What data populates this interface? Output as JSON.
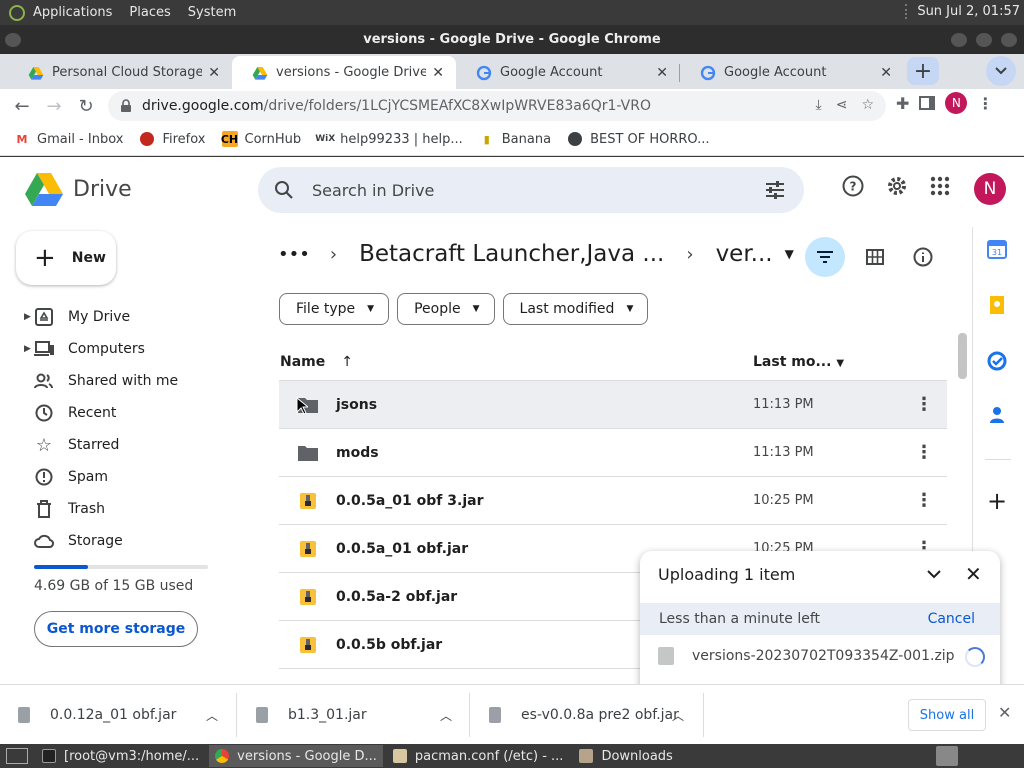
{
  "system_panel": {
    "menus": [
      "Applications",
      "Places",
      "System"
    ],
    "clock": "Sun Jul  2, 01:57"
  },
  "window": {
    "title": "versions - Google Drive - Google Chrome"
  },
  "tabs": [
    {
      "label": "Personal Cloud Storage & F",
      "icon": "google-drive-icon"
    },
    {
      "label": "versions - Google Drive",
      "icon": "google-drive-icon"
    },
    {
      "label": "Google Account",
      "icon": "google-icon"
    },
    {
      "label": "Google Account",
      "icon": "google-icon"
    }
  ],
  "address": {
    "host": "drive.google.com",
    "path": "/drive/folders/1LCjYCSMEAfXC8XwIpWRVE83a6Qr1-VRO"
  },
  "profile_initial": "N",
  "bookmarks": [
    {
      "label": "Gmail - Inbox",
      "icon": "gmail-icon"
    },
    {
      "label": "Firefox",
      "icon": "firefox-icon"
    },
    {
      "label": "CornHub",
      "icon": "ch-icon"
    },
    {
      "label": "help99233 | help...",
      "icon": "wix-icon"
    },
    {
      "label": "Banana",
      "icon": "banana-icon"
    },
    {
      "label": "BEST OF HORRO...",
      "icon": "globe-icon"
    }
  ],
  "drive": {
    "app_name": "Drive",
    "search_placeholder": "Search in Drive",
    "new_label": "New",
    "nav": [
      {
        "label": "My Drive",
        "icon": "my-drive-icon",
        "expandable": true
      },
      {
        "label": "Computers",
        "icon": "computers-icon",
        "expandable": true
      },
      {
        "label": "Shared with me",
        "icon": "shared-icon",
        "expandable": false
      },
      {
        "label": "Recent",
        "icon": "clock-icon",
        "expandable": false
      },
      {
        "label": "Starred",
        "icon": "star-icon",
        "expandable": false
      },
      {
        "label": "Spam",
        "icon": "spam-icon",
        "expandable": false
      },
      {
        "label": "Trash",
        "icon": "trash-icon",
        "expandable": false
      },
      {
        "label": "Storage",
        "icon": "cloud-icon",
        "expandable": false
      }
    ],
    "storage": {
      "used_text": "4.69 GB of 15 GB used",
      "fraction": 0.31
    },
    "get_storage_label": "Get more storage",
    "breadcrumb": {
      "parent": "Betacraft Launcher,Java ...",
      "current": "ver..."
    },
    "filters": [
      "File type",
      "People",
      "Last modified"
    ],
    "columns": {
      "name": "Name",
      "last_modified": "Last mo..."
    },
    "files": [
      {
        "name": "jsons",
        "modified": "11:13 PM",
        "kind": "folder",
        "selected": true
      },
      {
        "name": "mods",
        "modified": "11:13 PM",
        "kind": "folder",
        "selected": false
      },
      {
        "name": "0.0.5a_01 obf 3.jar",
        "modified": "10:25 PM",
        "kind": "jar",
        "selected": false
      },
      {
        "name": "0.0.5a_01 obf.jar",
        "modified": "10:25 PM",
        "kind": "jar",
        "selected": false
      },
      {
        "name": "0.0.5a-2 obf.jar",
        "modified": "",
        "kind": "jar",
        "selected": false
      },
      {
        "name": "0.0.5b obf.jar",
        "modified": "",
        "kind": "jar",
        "selected": false
      }
    ]
  },
  "upload": {
    "title": "Uploading 1 item",
    "status": "Less than a minute left",
    "cancel_label": "Cancel",
    "file_name": "versions-20230702T093354Z-001.zip"
  },
  "downloads": {
    "items": [
      "0.0.12a_01 obf.jar",
      "b1.3_01.jar",
      "es-v0.0.8a pre2 obf.jar"
    ],
    "show_all_label": "Show all"
  },
  "taskbar": {
    "tasks": [
      {
        "label": "[root@vm3:/home/...",
        "active": false
      },
      {
        "label": "versions - Google D...",
        "active": true
      },
      {
        "label": "pacman.conf (/etc) - ...",
        "active": false
      },
      {
        "label": "Downloads",
        "active": false
      }
    ]
  },
  "colors": {
    "accent": "#0b57d0",
    "avatar": "#c2185b",
    "selected_row": "#eceef1"
  }
}
